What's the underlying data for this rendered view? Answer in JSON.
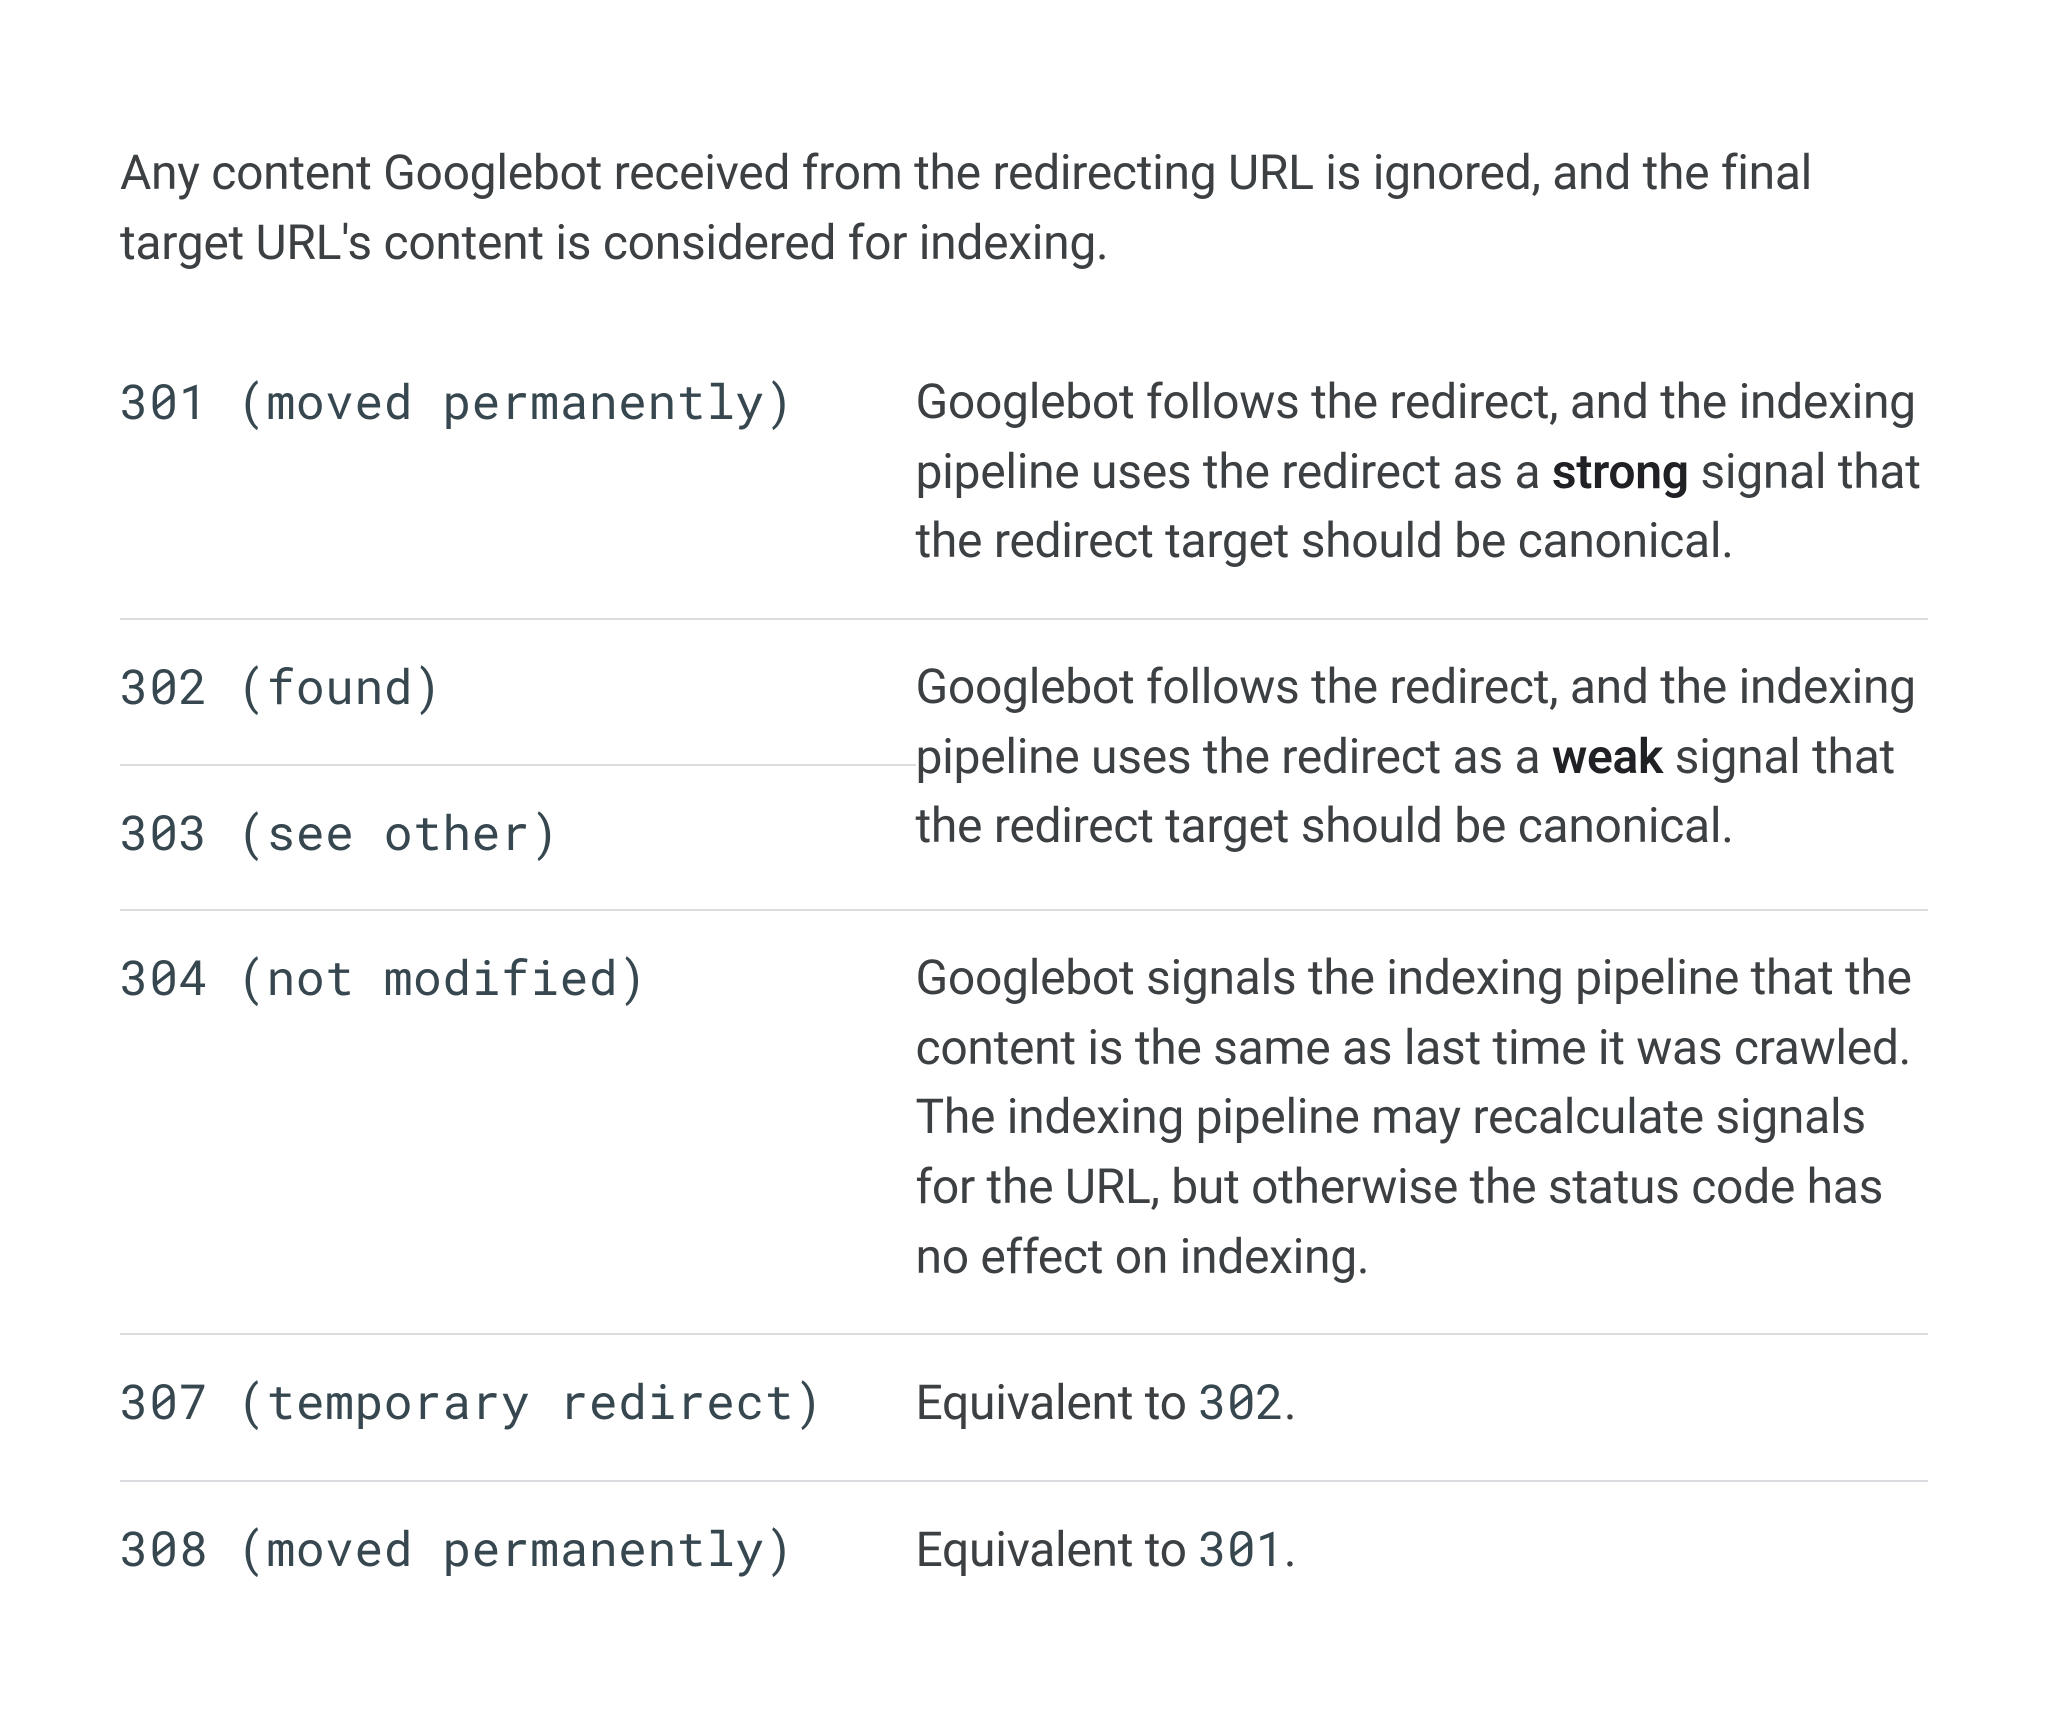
{
  "intro": "Any content Googlebot received from the redirecting URL is ignored, and the final target URL's content is considered for indexing.",
  "rows": {
    "r301": {
      "code": "301 (moved permanently)",
      "desc_pre": "Googlebot follows the redirect, and the indexing pipeline uses the redirect as a ",
      "desc_bold": "strong",
      "desc_post": " signal that the redirect target should be canonical."
    },
    "r302": {
      "code": "302 (found)",
      "desc_pre": "Googlebot follows the redirect, and the indexing pipeline uses the redirect as a ",
      "desc_bold": "weak",
      "desc_post": " signal that the redirect target should be canonical."
    },
    "r303": {
      "code": "303 (see other)"
    },
    "r304": {
      "code": "304 (not modified)",
      "desc": "Googlebot signals the indexing pipeline that the content is the same as last time it was crawled. The indexing pipeline may recalculate signals for the URL, but otherwise the status code has no effect on indexing."
    },
    "r307": {
      "code": "307 (temporary redirect)",
      "desc_pre": "Equivalent to ",
      "desc_code": "302",
      "desc_post": "."
    },
    "r308": {
      "code": "308 (moved permanently)",
      "desc_pre": "Equivalent to ",
      "desc_code": "301",
      "desc_post": "."
    }
  }
}
